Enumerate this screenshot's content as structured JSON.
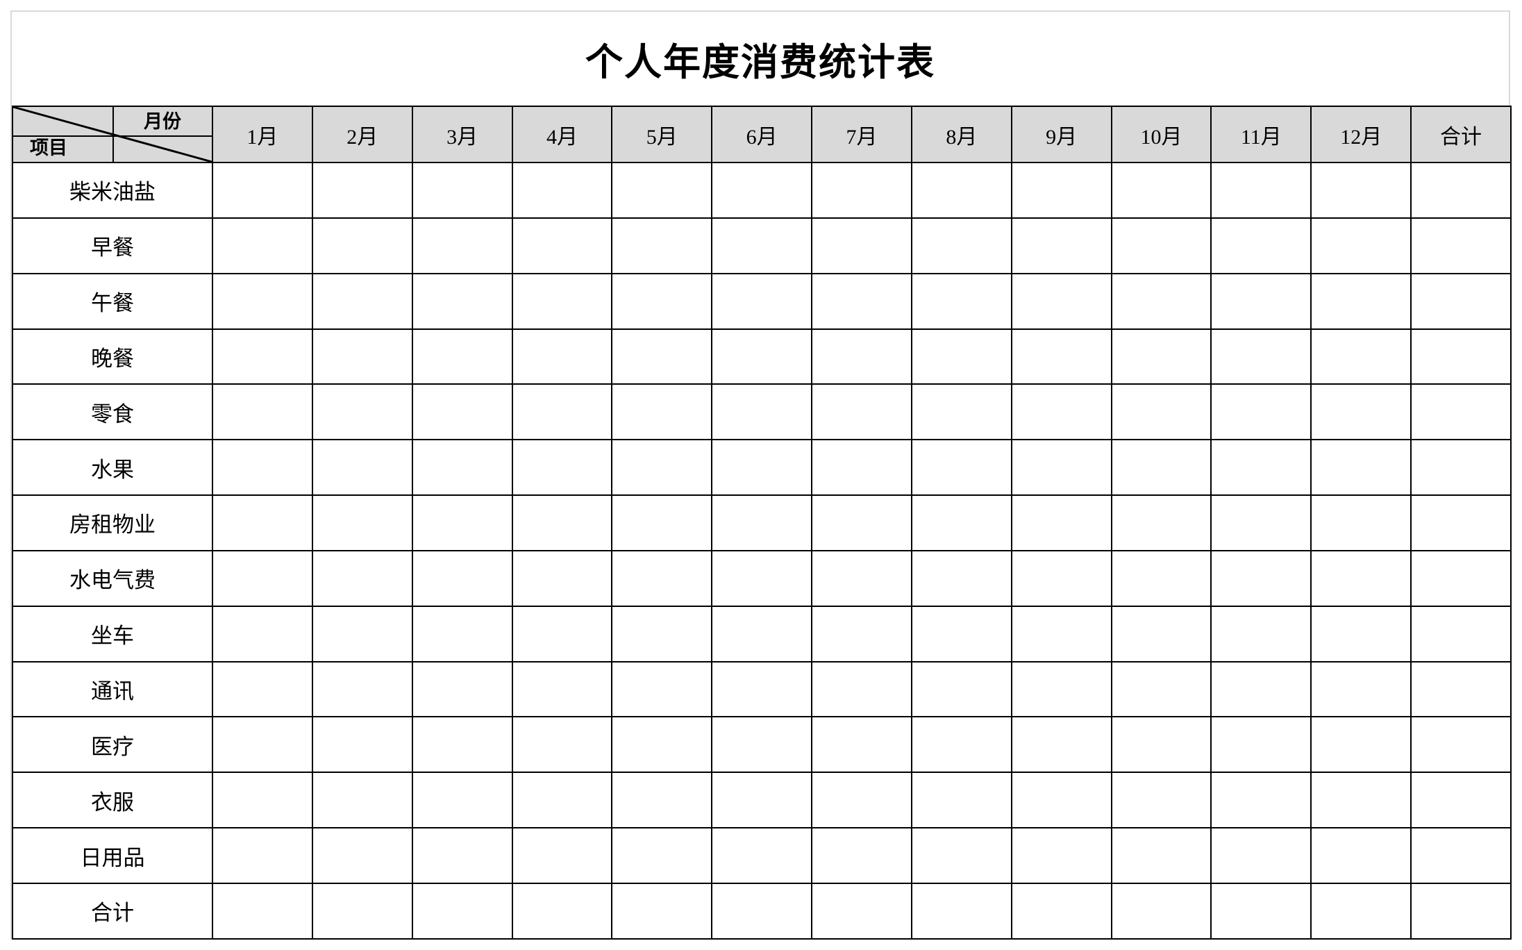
{
  "document": {
    "title": "个人年度消费统计表"
  },
  "table": {
    "corner": {
      "column_axis_label": "月份",
      "row_axis_label": "项目"
    },
    "column_headers": [
      "1月",
      "2月",
      "3月",
      "4月",
      "5月",
      "6月",
      "7月",
      "8月",
      "9月",
      "10月",
      "11月",
      "12月",
      "合计"
    ],
    "row_headers": [
      "柴米油盐",
      "早餐",
      "午餐",
      "晚餐",
      "零食",
      "水果",
      "房租物业",
      "水电气费",
      "坐车",
      "通讯",
      "医疗",
      "衣服",
      "日用品",
      "合计"
    ],
    "cells": [
      [
        "",
        "",
        "",
        "",
        "",
        "",
        "",
        "",
        "",
        "",
        "",
        "",
        ""
      ],
      [
        "",
        "",
        "",
        "",
        "",
        "",
        "",
        "",
        "",
        "",
        "",
        "",
        ""
      ],
      [
        "",
        "",
        "",
        "",
        "",
        "",
        "",
        "",
        "",
        "",
        "",
        "",
        ""
      ],
      [
        "",
        "",
        "",
        "",
        "",
        "",
        "",
        "",
        "",
        "",
        "",
        "",
        ""
      ],
      [
        "",
        "",
        "",
        "",
        "",
        "",
        "",
        "",
        "",
        "",
        "",
        "",
        ""
      ],
      [
        "",
        "",
        "",
        "",
        "",
        "",
        "",
        "",
        "",
        "",
        "",
        "",
        ""
      ],
      [
        "",
        "",
        "",
        "",
        "",
        "",
        "",
        "",
        "",
        "",
        "",
        "",
        ""
      ],
      [
        "",
        "",
        "",
        "",
        "",
        "",
        "",
        "",
        "",
        "",
        "",
        "",
        ""
      ],
      [
        "",
        "",
        "",
        "",
        "",
        "",
        "",
        "",
        "",
        "",
        "",
        "",
        ""
      ],
      [
        "",
        "",
        "",
        "",
        "",
        "",
        "",
        "",
        "",
        "",
        "",
        "",
        ""
      ],
      [
        "",
        "",
        "",
        "",
        "",
        "",
        "",
        "",
        "",
        "",
        "",
        "",
        ""
      ],
      [
        "",
        "",
        "",
        "",
        "",
        "",
        "",
        "",
        "",
        "",
        "",
        "",
        ""
      ],
      [
        "",
        "",
        "",
        "",
        "",
        "",
        "",
        "",
        "",
        "",
        "",
        "",
        ""
      ],
      [
        "",
        "",
        "",
        "",
        "",
        "",
        "",
        "",
        "",
        "",
        "",
        "",
        ""
      ]
    ]
  },
  "style": {
    "header_fill": "#d9d9d9",
    "grid_line": "#000000",
    "page_background": "#ffffff",
    "frame_line": "#d9d9d9"
  }
}
